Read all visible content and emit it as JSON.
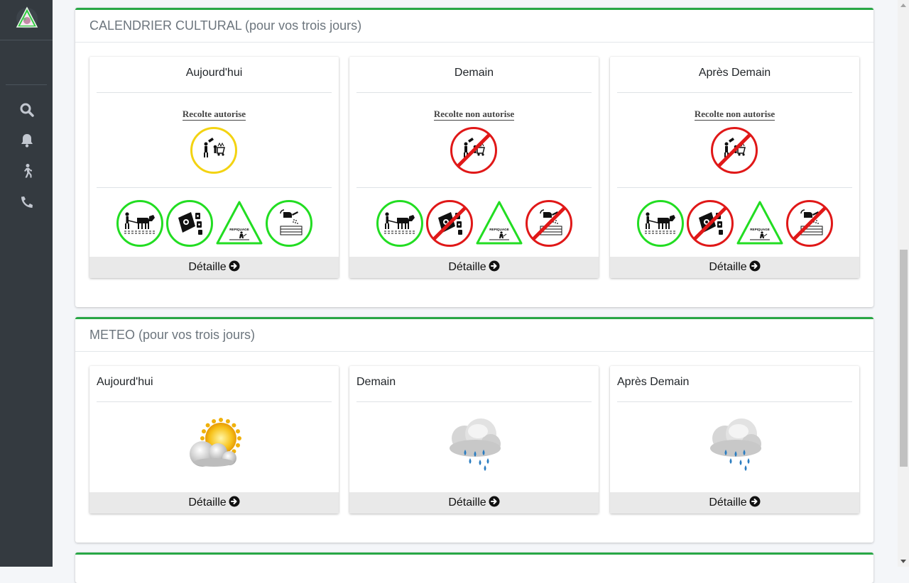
{
  "sidebar": {
    "icons": [
      "search-icon",
      "bell-icon",
      "walking-person-icon",
      "phone-icon"
    ]
  },
  "calendar": {
    "title": "CALENDRIER CULTURAL (pour vos trois jours)",
    "days": [
      {
        "label": "Aujourd'hui",
        "harvest_text": "Recolte autorise",
        "harvest_allowed": true,
        "activities": [
          {
            "icon": "ox-plough-icon",
            "allowed": true
          },
          {
            "icon": "fertilizer-bag-icon",
            "allowed": true
          },
          {
            "icon": "repiquage-warning-icon",
            "allowed": true,
            "text": "REPIQUAGE"
          },
          {
            "icon": "watering-can-icon",
            "allowed": true
          }
        ],
        "detail_label": "Détaille"
      },
      {
        "label": "Demain",
        "harvest_text": "Recolte non autorise",
        "harvest_allowed": false,
        "activities": [
          {
            "icon": "ox-plough-icon",
            "allowed": true
          },
          {
            "icon": "fertilizer-bag-icon",
            "allowed": false
          },
          {
            "icon": "repiquage-warning-icon",
            "allowed": true,
            "text": "REPIQUAGE"
          },
          {
            "icon": "watering-can-icon",
            "allowed": false
          }
        ],
        "detail_label": "Détaille"
      },
      {
        "label": "Après Demain",
        "harvest_text": "Recolte non autorise",
        "harvest_allowed": false,
        "activities": [
          {
            "icon": "ox-plough-icon",
            "allowed": true
          },
          {
            "icon": "fertilizer-bag-icon",
            "allowed": false
          },
          {
            "icon": "repiquage-warning-icon",
            "allowed": true,
            "text": "REPIQUAGE"
          },
          {
            "icon": "watering-can-icon",
            "allowed": false
          }
        ],
        "detail_label": "Détaille"
      }
    ]
  },
  "meteo": {
    "title": "METEO (pour vos trois jours)",
    "days": [
      {
        "label": "Aujourd'hui",
        "weather_icon": "sun-behind-clouds-icon",
        "detail_label": "Détaille"
      },
      {
        "label": "Demain",
        "weather_icon": "rain-cloud-icon",
        "detail_label": "Détaille"
      },
      {
        "label": "Après Demain",
        "weather_icon": "rain-cloud-icon",
        "detail_label": "Détaille"
      }
    ]
  },
  "colors": {
    "accent": "#28a745",
    "allowed": "#22dd22",
    "forbidden": "#e01818",
    "harvest_today": "#f3d312",
    "sidebar": "#343a40"
  }
}
